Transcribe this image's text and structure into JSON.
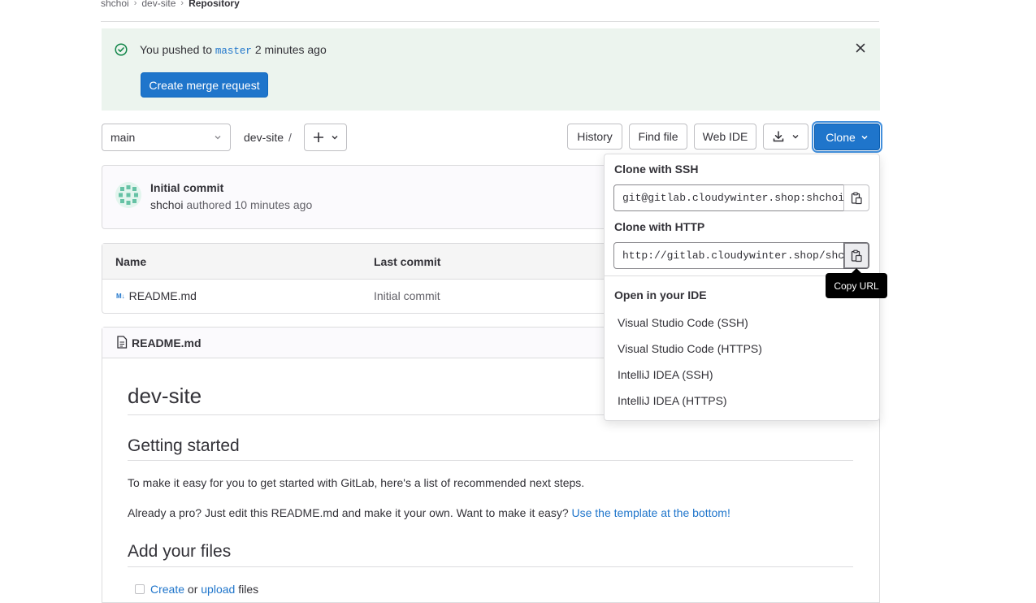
{
  "breadcrumb": {
    "items": [
      "shchoi",
      "dev-site",
      "Repository"
    ]
  },
  "alert": {
    "text_prefix": "You pushed to",
    "branch": "master",
    "text_suffix": "2 minutes ago",
    "button": "Create merge request",
    "icon": "check-circle-icon",
    "close_icon": "close-icon"
  },
  "toolbar": {
    "branch": "main",
    "path": "dev-site",
    "path_sep": "/",
    "history": "History",
    "find_file": "Find file",
    "web_ide": "Web IDE",
    "clone": "Clone"
  },
  "commit": {
    "title": "Initial commit",
    "author": "shchoi",
    "meta": "authored 10 minutes ago"
  },
  "files": {
    "headers": {
      "name": "Name",
      "last_commit": "Last commit"
    },
    "rows": [
      {
        "name": "README.md",
        "last_commit": "Initial commit",
        "icon_text": "M↓"
      }
    ]
  },
  "readme": {
    "header": "README.md",
    "h1": "dev-site",
    "h2_getting_started": "Getting started",
    "p1": "To make it easy for you to get started with GitLab, here's a list of recommended next steps.",
    "p2_text": "Already a pro? Just edit this README.md and make it your own. Want to make it easy?",
    "p2_link": "Use the template at the bottom!",
    "h2_add_files": "Add your files",
    "task_create": "Create",
    "task_or": "or",
    "task_upload": "upload",
    "task_files": "files"
  },
  "clone_dropdown": {
    "ssh_label": "Clone with SSH",
    "ssh_url": "git@gitlab.cloudywinter.shop:shchoi/dev-site.git",
    "http_label": "Clone with HTTP",
    "http_url": "http://gitlab.cloudywinter.shop/shchoi/dev-site.git",
    "ide_label": "Open in your IDE",
    "ide_items": [
      "Visual Studio Code (SSH)",
      "Visual Studio Code (HTTPS)",
      "IntelliJ IDEA (SSH)",
      "IntelliJ IDEA (HTTPS)"
    ],
    "tooltip": "Copy URL"
  },
  "colors": {
    "primary": "#1f75cb",
    "success_bg": "#ecf4ee",
    "success": "#108548"
  }
}
